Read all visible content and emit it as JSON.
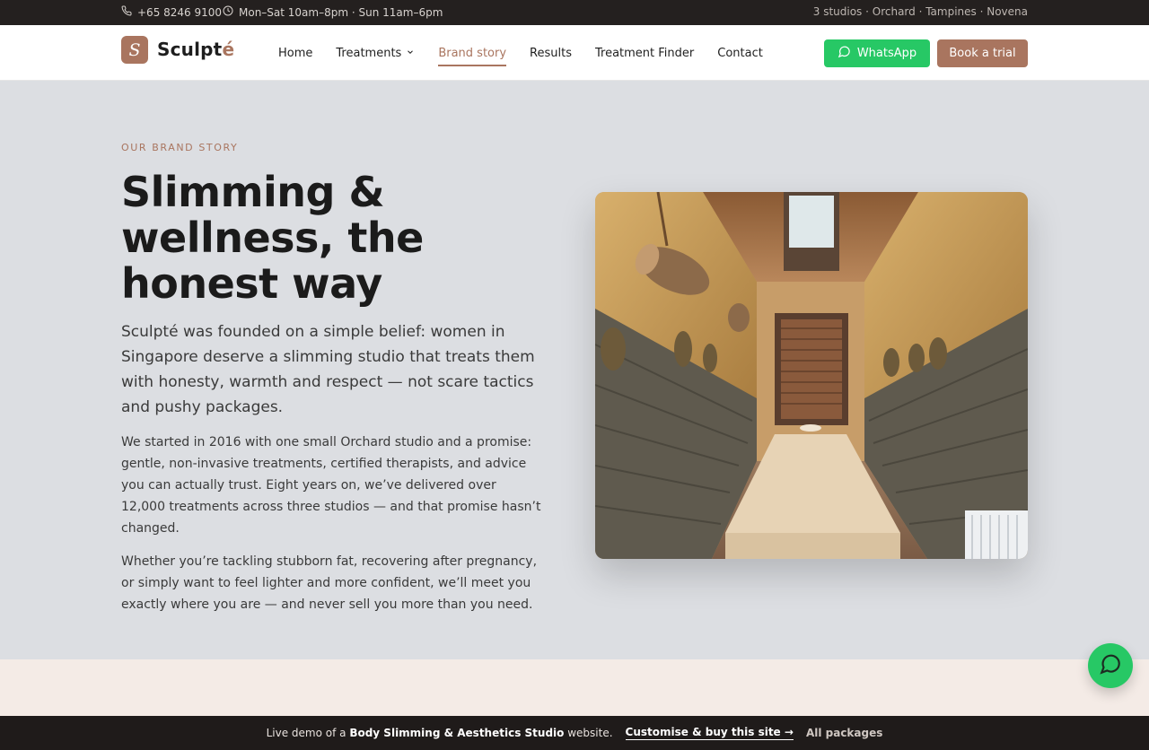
{
  "topbar": {
    "phone": "+65 8246 9100",
    "hours": "Mon–Sat 10am–8pm · Sun 11am–6pm",
    "studios": "3 studios · Orchard · Tampines · Novena"
  },
  "brand": {
    "mark": "S",
    "name_main": "Sculpt",
    "name_accent": "é",
    "accent_color": "#a9755f"
  },
  "nav": {
    "items": [
      {
        "label": "Home"
      },
      {
        "label": "Treatments"
      },
      {
        "label": "Brand story"
      },
      {
        "label": "Results"
      },
      {
        "label": "Treatment Finder"
      },
      {
        "label": "Contact"
      }
    ],
    "active": "Brand story",
    "whatsapp": "WhatsApp",
    "book": "Book a trial"
  },
  "hero": {
    "eyebrow": "OUR BRAND STORY",
    "title": "Slimming & wellness, the honest way",
    "lead": "Sculpté was founded on a simple belief: women in Singapore deserve a slimming studio that treats them with honesty, warmth and respect — not scare tactics and pushy packages.",
    "para1": "We started in 2016 with one small Orchard studio and a promise: gentle, non-invasive treatments, certified therapists, and advice you can actually trust. Eight years on, we’ve delivered over 12,000 treatments across three studios — and that promise hasn’t changed.",
    "para2": "Whether you’re tackling stubborn fat, recovering after pregnancy, or simply want to feel lighter and more confident, we’ll meet you exactly where you are — and never sell you more than you need."
  },
  "demo_bar": {
    "prefix": "Live demo of a",
    "site_type": "Body Slimming & Aesthetics Studio",
    "suffix": "website.",
    "buy": "Customise & buy this site →",
    "packages": "All packages"
  },
  "colors": {
    "whatsapp": "#27c865",
    "brand": "#a9755f",
    "hero_bg": "#dcdee2",
    "band_bg": "#f4ebe6",
    "topbar_bg": "#24201f"
  },
  "icons": [
    "phone-icon",
    "clock-icon",
    "chevron-down-icon",
    "whatsapp-icon",
    "chat-icon"
  ]
}
